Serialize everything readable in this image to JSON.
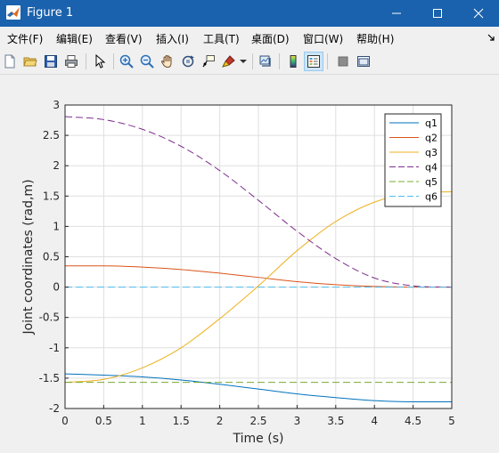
{
  "window": {
    "title": "Figure 1"
  },
  "menu": {
    "items": [
      {
        "label": "文件(F)"
      },
      {
        "label": "编辑(E)"
      },
      {
        "label": "查看(V)"
      },
      {
        "label": "插入(I)"
      },
      {
        "label": "工具(T)"
      },
      {
        "label": "桌面(D)"
      },
      {
        "label": "窗口(W)"
      },
      {
        "label": "帮助(H)"
      }
    ]
  },
  "chart_data": {
    "type": "line",
    "xlabel": "Time (s)",
    "ylabel": "Joint coordinates (rad,m)",
    "xlim": [
      0,
      5
    ],
    "ylim": [
      -2,
      3
    ],
    "xticks": [
      "0",
      "0.5",
      "1",
      "1.5",
      "2",
      "2.5",
      "3",
      "3.5",
      "4",
      "4.5",
      "5"
    ],
    "yticks": [
      "3",
      "2.5",
      "2",
      "1.5",
      "1",
      "0.5",
      "0",
      "-0.5",
      "-1",
      "-1.5",
      "-2"
    ],
    "grid": true,
    "legend_position": "top-right",
    "series": [
      {
        "name": "q1",
        "color": "#0072bd",
        "dash": "solid",
        "x": [
          0,
          0.5,
          1,
          1.5,
          2,
          2.5,
          3,
          3.5,
          4,
          4.5,
          5
        ],
        "y": [
          -1.43,
          -1.45,
          -1.48,
          -1.53,
          -1.6,
          -1.68,
          -1.76,
          -1.82,
          -1.87,
          -1.89,
          -1.89
        ]
      },
      {
        "name": "q2",
        "color": "#d95319",
        "dash": "solid",
        "x": [
          0,
          0.5,
          1,
          1.5,
          2,
          2.5,
          3,
          3.5,
          4,
          4.5,
          5
        ],
        "y": [
          0.35,
          0.35,
          0.33,
          0.29,
          0.23,
          0.16,
          0.09,
          0.04,
          0.01,
          0.0,
          0.0
        ]
      },
      {
        "name": "q3",
        "color": "#edb120",
        "dash": "solid",
        "x": [
          0,
          0.5,
          1,
          1.5,
          2,
          2.5,
          3,
          3.5,
          4,
          4.5,
          5
        ],
        "y": [
          -1.57,
          -1.52,
          -1.33,
          -1.0,
          -0.52,
          0.02,
          0.6,
          1.08,
          1.4,
          1.55,
          1.57
        ]
      },
      {
        "name": "q4",
        "color": "#7e2f8e",
        "dash": "dashed",
        "x": [
          0,
          0.5,
          1,
          1.5,
          2,
          2.5,
          3,
          3.5,
          4,
          4.5,
          5
        ],
        "y": [
          2.81,
          2.76,
          2.6,
          2.32,
          1.92,
          1.43,
          0.92,
          0.47,
          0.15,
          0.02,
          0.0
        ]
      },
      {
        "name": "q5",
        "color": "#77ac30",
        "dash": "dashed",
        "x": [
          0,
          5
        ],
        "y": [
          -1.57,
          -1.57
        ]
      },
      {
        "name": "q6",
        "color": "#4dbeee",
        "dash": "dashed",
        "x": [
          0,
          5
        ],
        "y": [
          0.0,
          0.0
        ]
      }
    ]
  }
}
